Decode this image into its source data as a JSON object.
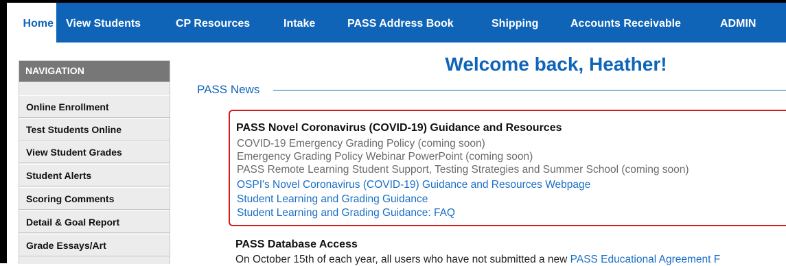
{
  "topnav": {
    "tabs": [
      {
        "label": "Home",
        "active": true
      },
      {
        "label": "View Students"
      },
      {
        "label": "CP Resources"
      },
      {
        "label": "Intake"
      },
      {
        "label": "PASS Address Book"
      },
      {
        "label": "Shipping"
      },
      {
        "label": "Accounts Receivable"
      },
      {
        "label": "ADMIN"
      }
    ]
  },
  "sidebar": {
    "header": "NAVIGATION",
    "items": [
      {
        "label": "Online Enrollment"
      },
      {
        "label": "Test Students Online"
      },
      {
        "label": "View Student Grades"
      },
      {
        "label": "Student Alerts"
      },
      {
        "label": "Scoring Comments"
      },
      {
        "label": "Detail & Goal Report"
      },
      {
        "label": "Grade Essays/Art"
      }
    ]
  },
  "main": {
    "welcome": "Welcome back, Heather!",
    "news_legend": "PASS News",
    "covid": {
      "title": "PASS Novel Coronavirus (COVID-19) Guidance and Resources",
      "items": [
        {
          "text": "COVID-19 Emergency Grading Policy (coming soon)",
          "link": false
        },
        {
          "text": "Emergency Grading Policy Webinar PowerPoint (coming soon)",
          "link": false
        },
        {
          "text": "PASS Remote Learning Student Support, Testing Strategies and Summer School (coming soon)",
          "link": false
        },
        {
          "text": "OSPI's Novel Coronavirus (COVID-19) Guidance and Resources Webpage",
          "link": true
        },
        {
          "text": "Student Learning and Grading Guidance",
          "link": true
        },
        {
          "text": "Student Learning and Grading Guidance: FAQ",
          "link": true
        }
      ]
    },
    "database": {
      "title": "PASS Database Access",
      "text_prefix": "On October 15th of each year, all users who have not submitted a new ",
      "text_link": "PASS Educational Agreement F"
    }
  },
  "colors": {
    "nav_blue": "#0f64b8",
    "link_blue": "#1a6ec7",
    "alert_red": "#d31c1c",
    "sidebar_header": "#777777"
  }
}
